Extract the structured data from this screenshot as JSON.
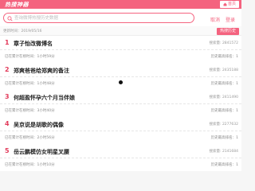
{
  "header": {
    "logo": "热搜神器",
    "home_label": "首页"
  },
  "search": {
    "placeholder": "查询微博热搜历史数据",
    "cancel_label": "取消",
    "login_label": "登录"
  },
  "timebar": {
    "update_time": "更新时间：2019/05/16",
    "history_label": "热搜历史"
  },
  "items": [
    {
      "rank": "1",
      "title": "章子怡改微博名",
      "count": "搜索量: 2841572",
      "on_time": "已在累计在榜时间：1小时59分",
      "peak": "历史最高排名：1"
    },
    {
      "rank": "2",
      "title": "郑爽爸爸给郑爽的备注",
      "count": "搜索量: 2435188",
      "on_time": "已在累计在榜时间：1小时48分",
      "peak": "历史最高排名：1"
    },
    {
      "rank": "3",
      "title": "何超盈怀孕六个月当伴娘",
      "count": "搜索量: 2411490",
      "on_time": "已在累计在榜时间：3小时40分",
      "peak": "历史最高排名：1"
    },
    {
      "rank": "4",
      "title": "吴京说是胡歌的偶像",
      "count": "搜索量: 2277632",
      "on_time": "已在累计在榜时间：2小时56分",
      "peak": "历史最高排名：1"
    },
    {
      "rank": "5",
      "title": "岳云鹏模仿女明星叉腰",
      "count": "搜索量: 2141684",
      "on_time": "已在累计在榜时间：1小时10分",
      "peak": "历史最高排名：1"
    }
  ],
  "colors": {
    "brand": "#f4637f",
    "rank": "#e23b5b"
  }
}
